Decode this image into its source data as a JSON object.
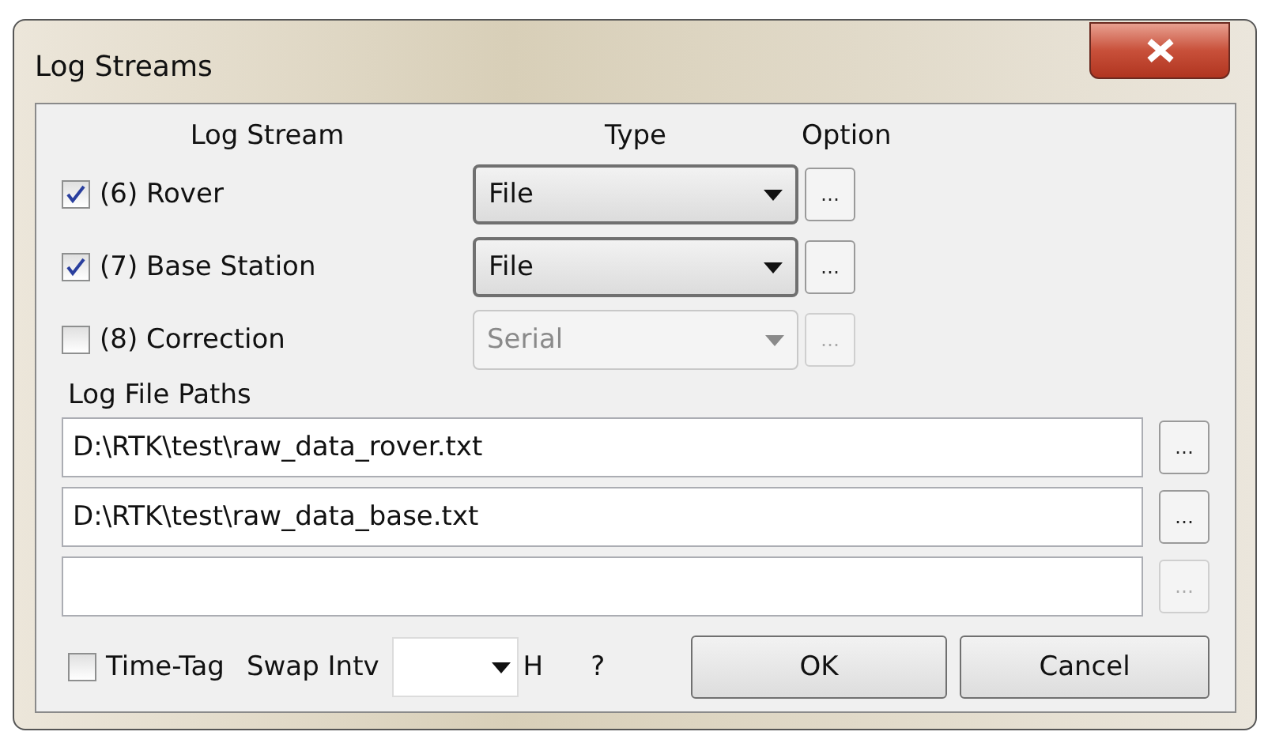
{
  "window": {
    "title": "Log Streams"
  },
  "columns": [
    "Log Stream",
    "Type",
    "Option"
  ],
  "streams": [
    {
      "label": "(6) Rover",
      "checked": true,
      "type": "File",
      "disabled": false,
      "option": "…"
    },
    {
      "label": "(7) Base Station",
      "checked": true,
      "type": "File",
      "disabled": false,
      "option": "…"
    },
    {
      "label": "(8) Correction",
      "checked": false,
      "type": "Serial",
      "disabled": true,
      "option": "…"
    }
  ],
  "paths_label": "Log File Paths",
  "paths": [
    {
      "value": "D:\\RTK\\test\\raw_data_rover.txt",
      "disabled": false,
      "browse": "…"
    },
    {
      "value": "D:\\RTK\\test\\raw_data_base.txt",
      "disabled": false,
      "browse": "…"
    },
    {
      "disabled": true,
      "browse": "…"
    }
  ],
  "time_tag": {
    "label": "Time-Tag",
    "checked": false
  },
  "swap": {
    "label": "Swap Intv",
    "unit": "H",
    "help": "?"
  },
  "buttons": [
    "OK",
    "Cancel"
  ]
}
